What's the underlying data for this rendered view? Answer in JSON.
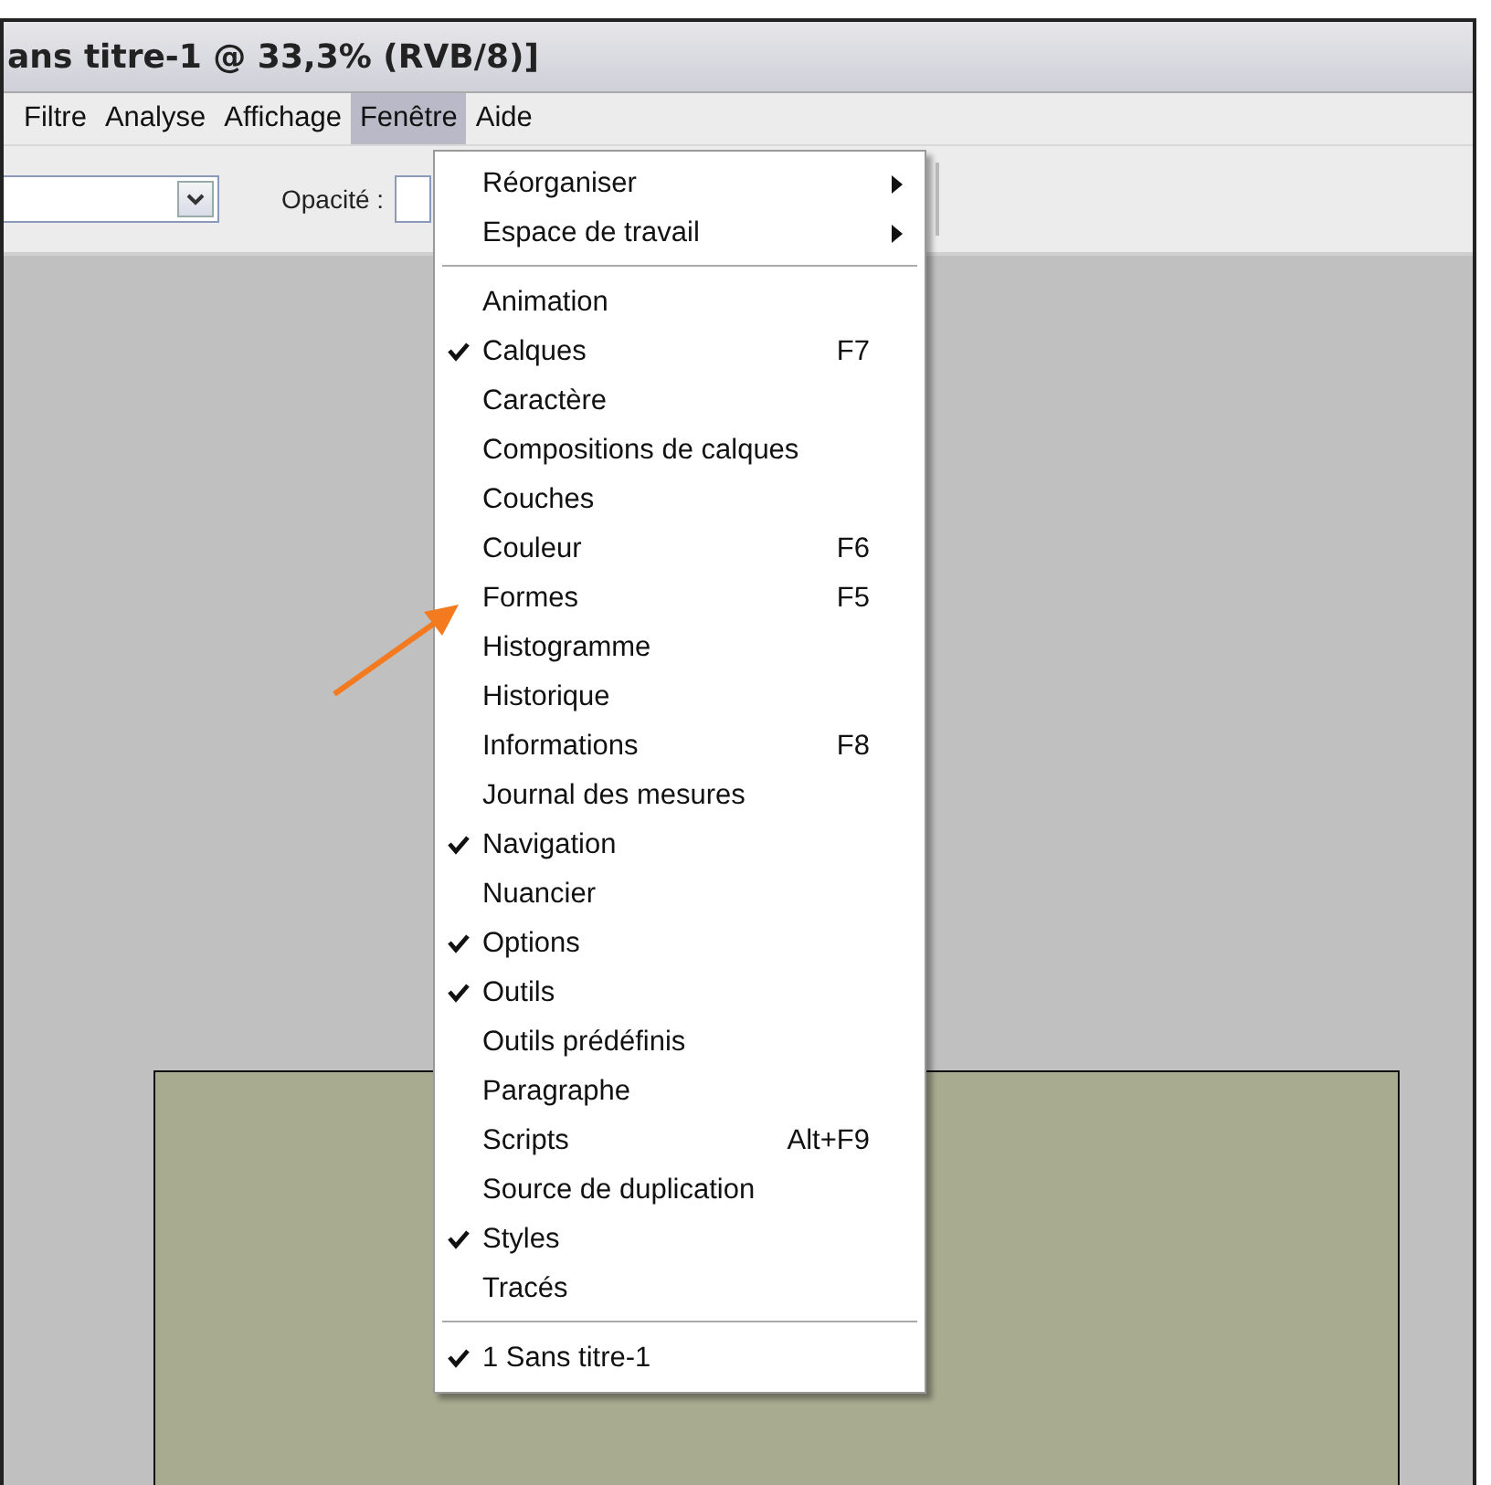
{
  "window": {
    "title": "ans titre-1 @ 33,3% (RVB/8)]"
  },
  "menu_bar": [
    {
      "label": "Filtre",
      "selected": false
    },
    {
      "label": "Analyse",
      "selected": false
    },
    {
      "label": "Affichage",
      "selected": false
    },
    {
      "label": "Fenêtre",
      "selected": true
    },
    {
      "label": "Aide",
      "selected": false
    }
  ],
  "toolbar": {
    "opacity_label": "Opacité :"
  },
  "menu": {
    "sections": [
      [
        {
          "label": "Réorganiser",
          "checked": false,
          "submenu": true
        },
        {
          "label": "Espace de travail",
          "checked": false,
          "submenu": true
        }
      ],
      [
        {
          "label": "Animation",
          "checked": false,
          "submenu": false
        },
        {
          "label": "Calques",
          "checked": true,
          "submenu": false,
          "shortcut": "F7"
        },
        {
          "label": "Caractère",
          "checked": false,
          "submenu": false
        },
        {
          "label": "Compositions de calques",
          "checked": false,
          "submenu": false
        },
        {
          "label": "Couches",
          "checked": false,
          "submenu": false
        },
        {
          "label": "Couleur",
          "checked": false,
          "submenu": false,
          "shortcut": "F6"
        },
        {
          "label": "Formes",
          "checked": false,
          "submenu": false,
          "shortcut": "F5"
        },
        {
          "label": "Histogramme",
          "checked": false,
          "submenu": false
        },
        {
          "label": "Historique",
          "checked": false,
          "submenu": false
        },
        {
          "label": "Informations",
          "checked": false,
          "submenu": false,
          "shortcut": "F8"
        },
        {
          "label": "Journal des mesures",
          "checked": false,
          "submenu": false
        },
        {
          "label": "Navigation",
          "checked": true,
          "submenu": false
        },
        {
          "label": "Nuancier",
          "checked": false,
          "submenu": false
        },
        {
          "label": "Options",
          "checked": true,
          "submenu": false
        },
        {
          "label": "Outils",
          "checked": true,
          "submenu": false
        },
        {
          "label": "Outils prédéfinis",
          "checked": false,
          "submenu": false
        },
        {
          "label": "Paragraphe",
          "checked": false,
          "submenu": false
        },
        {
          "label": "Scripts",
          "checked": false,
          "submenu": false,
          "shortcut": "Alt+F9"
        },
        {
          "label": "Source de duplication",
          "checked": false,
          "submenu": false
        },
        {
          "label": "Styles",
          "checked": true,
          "submenu": false
        },
        {
          "label": "Tracés",
          "checked": false,
          "submenu": false
        }
      ],
      [
        {
          "label": "1 Sans titre-1",
          "checked": true,
          "submenu": false
        }
      ]
    ]
  }
}
